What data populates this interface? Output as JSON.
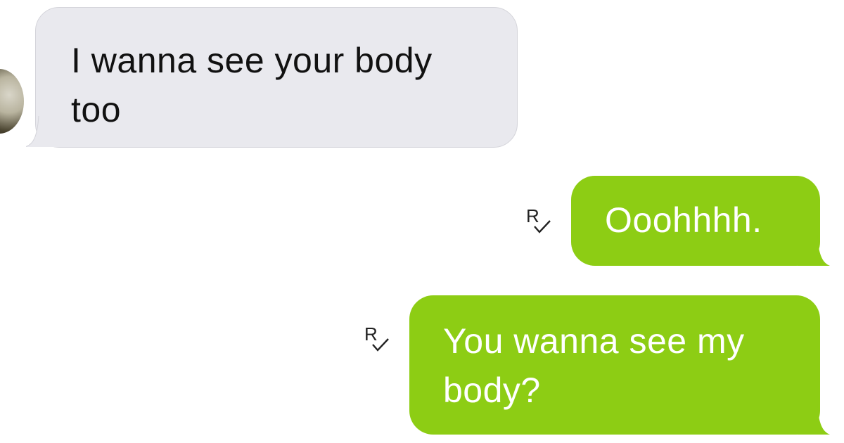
{
  "colors": {
    "incoming_bubble": "#e9e9ee",
    "outgoing_bubble": "#8dcd14",
    "incoming_text": "#111111",
    "outgoing_text": "#ffffff"
  },
  "conversation": {
    "contact_avatar_icon": "avatar",
    "messages": [
      {
        "direction": "incoming",
        "text_lines": [
          "I wanna see your body",
          "too"
        ]
      },
      {
        "direction": "outgoing",
        "text_lines": [
          "Ooohhhh."
        ],
        "receipt_icon": "read-receipt-icon"
      },
      {
        "direction": "outgoing",
        "text_lines": [
          "You wanna see my",
          "body?"
        ],
        "receipt_icon": "read-receipt-icon"
      }
    ]
  }
}
